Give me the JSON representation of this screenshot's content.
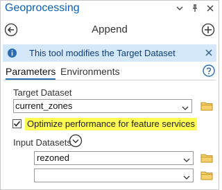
{
  "window": {
    "title": "Geoprocessing"
  },
  "nav": {
    "tool_name": "Append"
  },
  "banner": {
    "text": "This tool modifies the Target Dataset"
  },
  "tabs": [
    {
      "label": "Parameters",
      "active": true
    },
    {
      "label": "Environments",
      "active": false
    }
  ],
  "params": {
    "target_dataset": {
      "label": "Target Dataset",
      "value": "current_zones"
    },
    "optimize": {
      "label": "Optimize performance for feature services",
      "checked": true
    },
    "input_datasets": {
      "label": "Input Datasets",
      "values": [
        "rezoned",
        ""
      ]
    }
  },
  "colors": {
    "title": "#0b5fb0",
    "banner_bg": "#d4e8f9",
    "highlight": "#fdfb52",
    "accent": "#2b6cb0",
    "folder": "#e8b43a"
  },
  "icons": {
    "titlebar": [
      "chevron-down-icon",
      "pin-icon",
      "close-icon"
    ],
    "nav": [
      "back-icon",
      "add-icon"
    ],
    "banner": [
      "info-icon",
      "close-icon"
    ],
    "help": "help-icon",
    "browse": "folder-icon",
    "expand": "chevron-down-circle-icon"
  }
}
